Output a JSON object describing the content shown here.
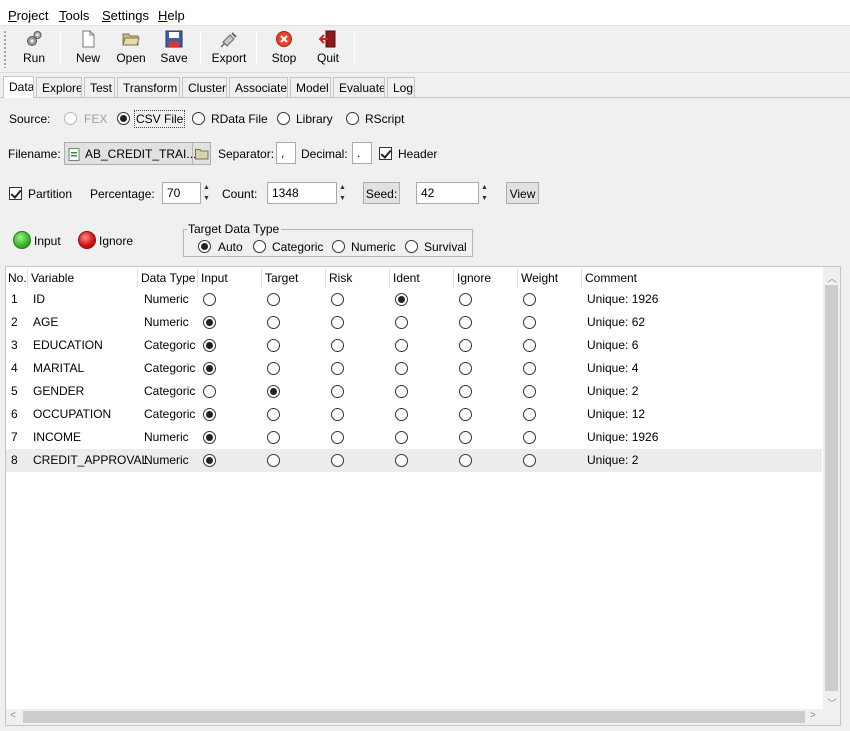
{
  "menu": [
    {
      "label": "Project",
      "key": "P",
      "rest": "roject"
    },
    {
      "label": "Tools",
      "key": "T",
      "rest": "ools"
    },
    {
      "label": "Settings",
      "key": "S",
      "rest": "ettings"
    },
    {
      "label": "Help",
      "key": "H",
      "rest": "elp"
    }
  ],
  "toolbar": {
    "run": "Run",
    "new": "New",
    "open": "Open",
    "save": "Save",
    "export": "Export",
    "stop": "Stop",
    "quit": "Quit"
  },
  "tabs": [
    "Data",
    "Explore",
    "Test",
    "Transform",
    "Cluster",
    "Associate",
    "Model",
    "Evaluate",
    "Log"
  ],
  "source": {
    "label": "Source:",
    "options": [
      "FEX",
      "CSV File",
      "RData File",
      "Library",
      "RScript"
    ],
    "selected": "CSV File"
  },
  "file": {
    "filename_label": "Filename:",
    "filename": "AB_CREDIT_TRAI...",
    "separator_label": "Separator:",
    "separator": ",",
    "decimal_label": "Decimal:",
    "decimal": ".",
    "header_label": "Header",
    "header_checked": true
  },
  "partition": {
    "label": "Partition",
    "checked": true,
    "percentage_label": "Percentage:",
    "percentage": "70",
    "count_label": "Count:",
    "count": "1348",
    "seed_button": "Seed:",
    "seed": "42",
    "view_button": "View"
  },
  "legend": {
    "input": "Input",
    "ignore": "Ignore"
  },
  "target_type": {
    "title": "Target Data Type",
    "options": [
      "Auto",
      "Categoric",
      "Numeric",
      "Survival"
    ],
    "selected": "Auto"
  },
  "table": {
    "headers": [
      "No.",
      "Variable",
      "Data Type",
      "Input",
      "Target",
      "Risk",
      "Ident",
      "Ignore",
      "Weight",
      "Comment"
    ],
    "rows": [
      {
        "no": "1",
        "variable": "ID",
        "type": "Numeric",
        "role": "Ident",
        "comment": "Unique: 1926"
      },
      {
        "no": "2",
        "variable": "AGE",
        "type": "Numeric",
        "role": "Input",
        "comment": "Unique: 62"
      },
      {
        "no": "3",
        "variable": "EDUCATION",
        "type": "Categoric",
        "role": "Input",
        "comment": "Unique: 6"
      },
      {
        "no": "4",
        "variable": "MARITAL",
        "type": "Categoric",
        "role": "Input",
        "comment": "Unique: 4"
      },
      {
        "no": "5",
        "variable": "GENDER",
        "type": "Categoric",
        "role": "Target",
        "comment": "Unique: 2"
      },
      {
        "no": "6",
        "variable": "OCCUPATION",
        "type": "Categoric",
        "role": "Input",
        "comment": "Unique: 12"
      },
      {
        "no": "7",
        "variable": "INCOME",
        "type": "Numeric",
        "role": "Input",
        "comment": "Unique: 1926"
      },
      {
        "no": "8",
        "variable": "CREDIT_APPROVAL",
        "type": "Numeric",
        "role": "Input",
        "comment": "Unique: 2"
      }
    ],
    "highlighted_row": "8"
  },
  "colors": {
    "input_dot": "#3cb82c",
    "ignore_dot": "#d41414",
    "stop_icon": "#e8412c"
  }
}
